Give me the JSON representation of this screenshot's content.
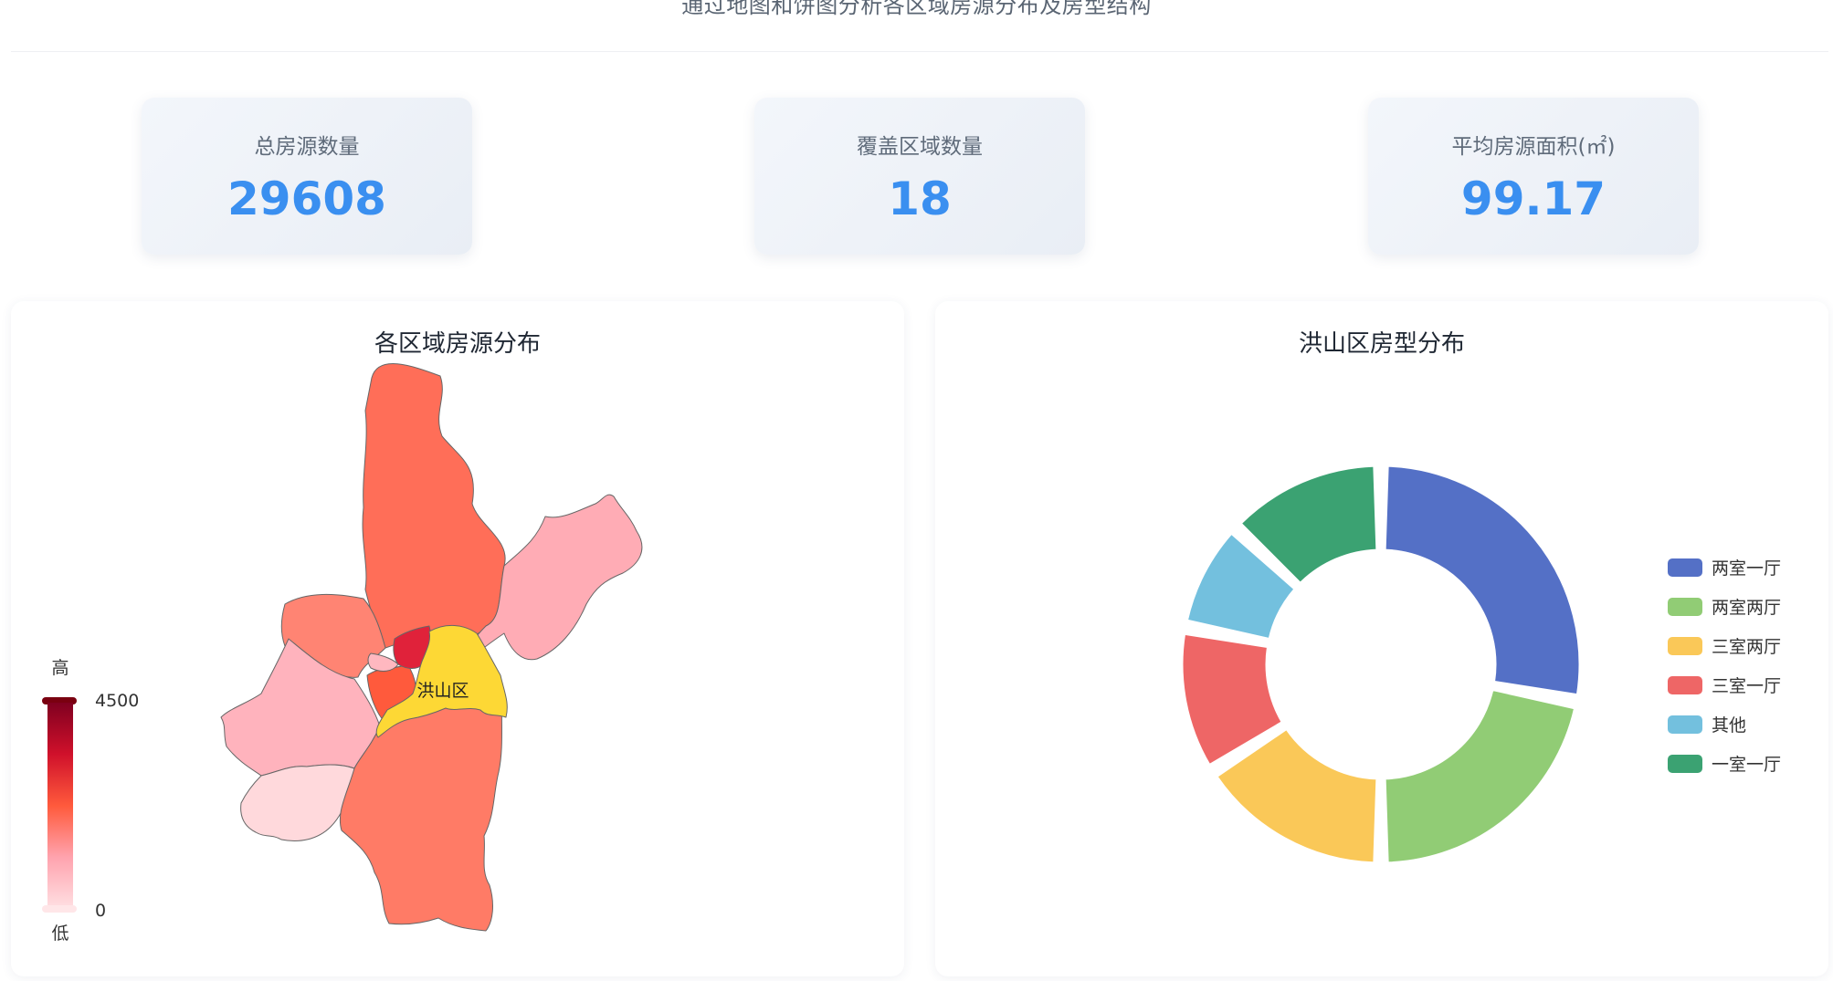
{
  "header": {
    "subtitle": "通过地图和饼图分析各区域房源分布及房型结构"
  },
  "stats": [
    {
      "label": "总房源数量",
      "value": "29608"
    },
    {
      "label": "覆盖区域数量",
      "value": "18"
    },
    {
      "label": "平均房源面积(㎡)",
      "value": "99.17"
    }
  ],
  "chart_data": [
    {
      "type": "map",
      "title": "各区域房源分布",
      "highlighted_region": "洪山区",
      "visual_map": {
        "high_label": "高",
        "low_label": "低",
        "max": 4500,
        "min": 0,
        "max_label": "4500",
        "min_label": "0"
      },
      "colors": {
        "highlight": "#fdd835",
        "border": "#666666"
      }
    },
    {
      "type": "pie",
      "title": "洪山区房型分布",
      "donut": true,
      "legend_position": "right",
      "slices": [
        {
          "name": "两室一厅",
          "value": 28,
          "color": "#5470c6"
        },
        {
          "name": "两室两厅",
          "value": 22,
          "color": "#91cc75"
        },
        {
          "name": "三室两厅",
          "value": 16,
          "color": "#fac858"
        },
        {
          "name": "三室一厅",
          "value": 12,
          "color": "#ee6666"
        },
        {
          "name": "其他",
          "value": 9,
          "color": "#73c0de"
        },
        {
          "name": "一室一厅",
          "value": 13,
          "color": "#3ba272"
        }
      ]
    }
  ]
}
